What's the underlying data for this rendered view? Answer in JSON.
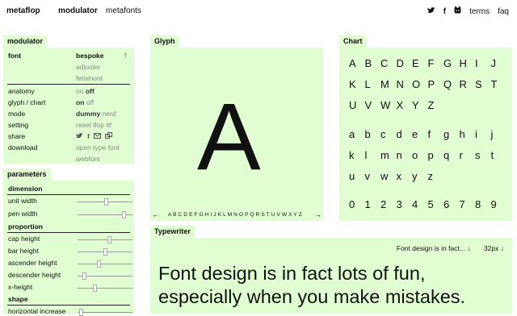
{
  "nav": {
    "logo": "metaflop",
    "tool_active": "modulator",
    "tool_other": "metafonts",
    "icons": [
      "twitter-icon",
      "facebook-icon",
      "github-icon"
    ],
    "links": [
      "terms",
      "faq"
    ]
  },
  "modulator": {
    "tab": "modulator",
    "font_label": "font",
    "font_options": [
      "bespoke",
      "adjuster",
      "fetamont"
    ],
    "up_arrow": "↑",
    "rows": [
      {
        "label": "anatomy",
        "values": [
          "on",
          "off"
        ],
        "selected": 1
      },
      {
        "label": "glyph / chart",
        "values": [
          "on",
          "off"
        ],
        "selected": 0
      },
      {
        "label": "mode",
        "values": [
          "dummy",
          "nerd"
        ],
        "selected": 0
      },
      {
        "label": "setting",
        "values": [
          "reset",
          "flop",
          "itf"
        ],
        "selected": -1
      },
      {
        "label": "share",
        "values": [
          "tw",
          "f",
          "mail",
          "link"
        ],
        "selected": -1
      },
      {
        "label": "download",
        "values": [
          "open type font",
          "webfont"
        ],
        "selected": -1
      }
    ]
  },
  "parameters": {
    "tab": "parameters",
    "dimension": "dimension",
    "unit_width": "unit width",
    "pen_width": "pen width",
    "proportion": "proportion",
    "cap_height": "cap height",
    "bar_height": "bar height",
    "ascender_height": "ascender height",
    "descender_height": "descender height",
    "x_height": "x-height",
    "shape": "shape",
    "horizontal_increase": "horizontal increase",
    "levels": {
      "unit_width": 0.52,
      "pen_width": 0.88,
      "cap_height": 0.58,
      "bar_height": 0.5,
      "ascender_height": 0.38,
      "descender_height": 0.1,
      "x_height": 0.3,
      "horizontal_increase": 0.03
    }
  },
  "glyph": {
    "tab": "Glyph",
    "char": "A",
    "prev": "←",
    "next": "→",
    "strip": "A B C D E F G H I J K L M N O P Q R S T U V W X Y Z"
  },
  "chart": {
    "tab": "Chart",
    "rows": [
      [
        "A",
        "B",
        "C",
        "D",
        "E",
        "F",
        "G",
        "H",
        "I",
        "J"
      ],
      [
        "K",
        "L",
        "M",
        "N",
        "O",
        "P",
        "Q",
        "R",
        "S",
        "T"
      ],
      [
        "U",
        "V",
        "W",
        "X",
        "Y",
        "Z"
      ],
      [
        "a",
        "b",
        "c",
        "d",
        "e",
        "f",
        "g",
        "h",
        "i",
        "j"
      ],
      [
        "k",
        "l",
        "m",
        "n",
        "o",
        "p",
        "q",
        "r",
        "s",
        "t"
      ],
      [
        "u",
        "v",
        "w",
        "x",
        "y",
        "z"
      ],
      [
        "0",
        "1",
        "2",
        "3",
        "4",
        "5",
        "6",
        "7",
        "8",
        "9"
      ]
    ]
  },
  "typewriter": {
    "tab": "Typewriter",
    "sample_select": "Font design is in fact...",
    "size_select": "32px",
    "dropdown_arrow": "↓",
    "line1": "Font design is in fact lots of fun,",
    "line2": "especially when you make mistakes."
  }
}
